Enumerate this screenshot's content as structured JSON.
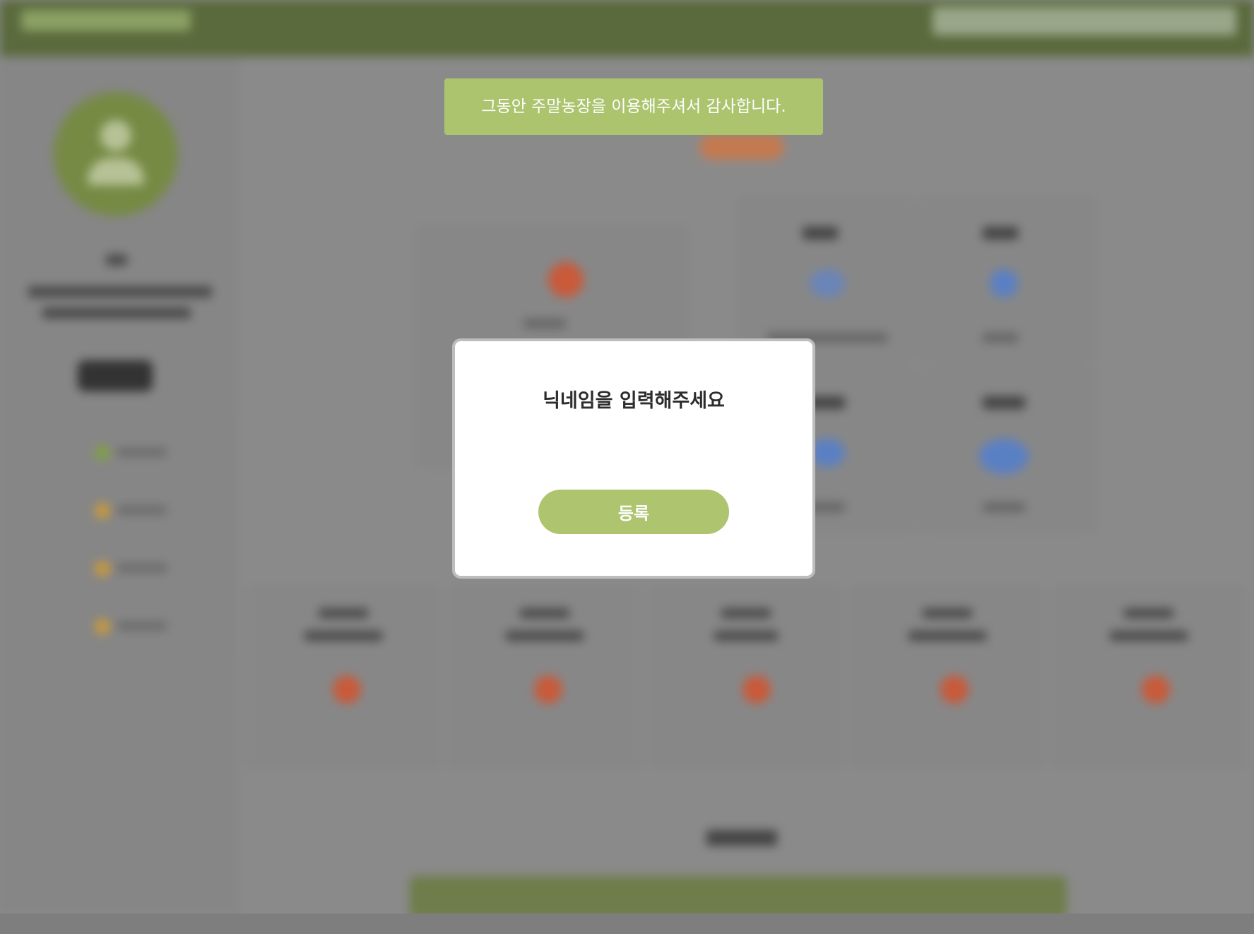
{
  "toast": {
    "message": "그동안 주말농장을 이용해주셔서 감사합니다."
  },
  "modal": {
    "title": "닉네임을 입력해주세요",
    "submit_label": "등록"
  }
}
